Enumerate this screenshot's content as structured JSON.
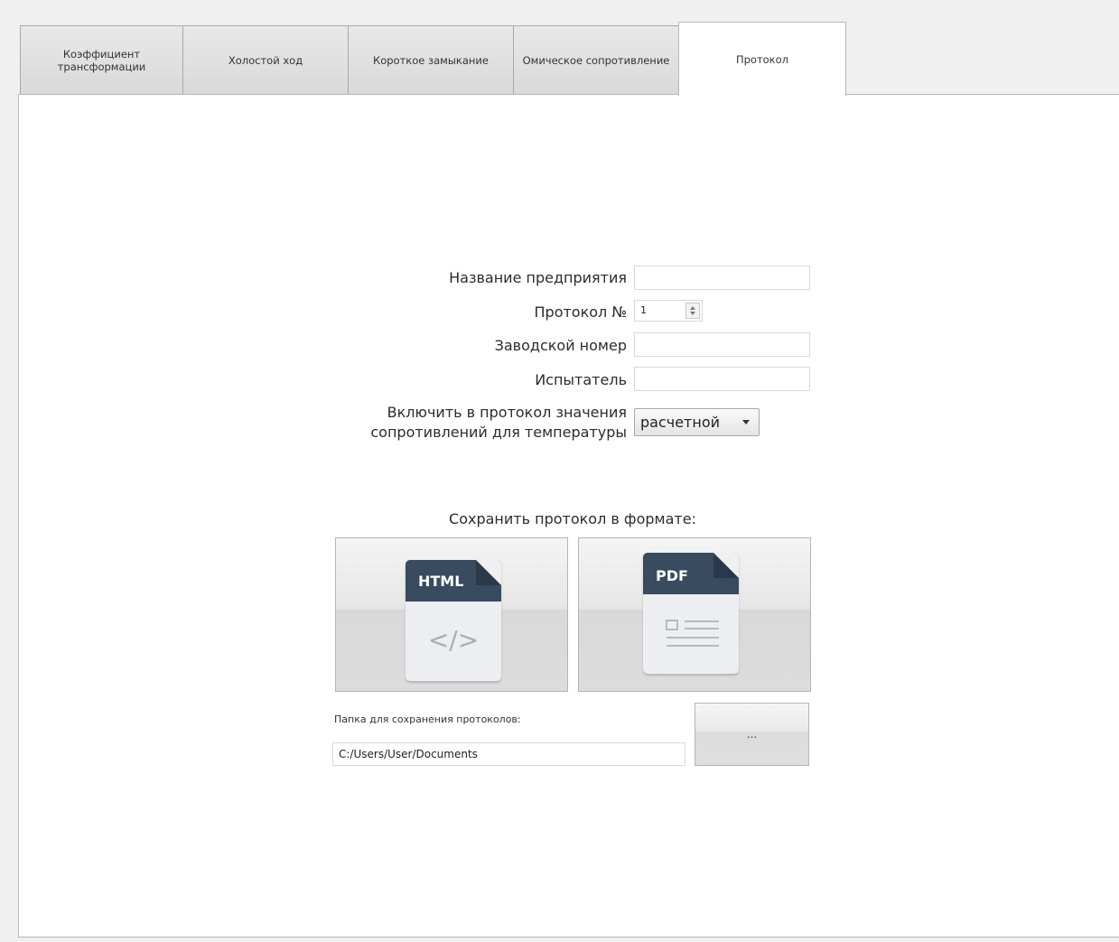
{
  "tabs": [
    {
      "label": "Коэффициент трансформации"
    },
    {
      "label": "Холостой ход"
    },
    {
      "label": "Короткое замыкание"
    },
    {
      "label": "Омическое сопротивление"
    },
    {
      "label": "Протокол"
    }
  ],
  "form": {
    "company_label": "Название предприятия",
    "company_value": "",
    "protocol_label": "Протокол №",
    "protocol_value": "1",
    "serial_label": "Заводской номер",
    "serial_value": "",
    "tester_label": "Испытатель",
    "tester_value": "",
    "include_label": "Включить в протокол значения сопротивлений для температуры",
    "include_selected": "расчетной"
  },
  "save": {
    "heading": "Сохранить протокол в формате:",
    "html_label": "HTML",
    "html_code": "</>",
    "pdf_label": "PDF",
    "folder_label": "Папка для сохранения протоколов:",
    "folder_value": "C:/Users/User/Documents",
    "browse_label": "..."
  },
  "icons": {
    "spin": "spinbox-arrows-icon",
    "dropdown": "chevron-down-icon",
    "html": "html-file-icon",
    "pdf": "pdf-file-icon"
  },
  "colors": {
    "doc_header": "#384b5f",
    "doc_body": "#eceef1"
  }
}
